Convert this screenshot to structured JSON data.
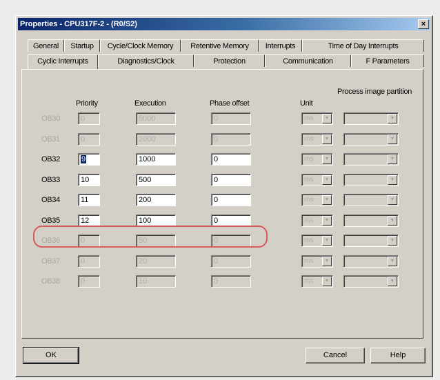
{
  "window": {
    "title": "Properties - CPU317F-2 - (R0/S2)",
    "close_glyph": "×"
  },
  "tabs": {
    "row1": [
      {
        "label": "General"
      },
      {
        "label": "Startup"
      },
      {
        "label": "Cycle/Clock Memory"
      },
      {
        "label": "Retentive Memory"
      },
      {
        "label": "Interrupts"
      },
      {
        "label": "Time of Day Interrupts"
      }
    ],
    "row2": [
      {
        "label": "Cyclic Interrupts",
        "active": true
      },
      {
        "label": "Diagnostics/Clock"
      },
      {
        "label": "Protection"
      },
      {
        "label": "Communication"
      },
      {
        "label": "F Parameters"
      }
    ]
  },
  "headers": {
    "priority": "Priority",
    "execution": "Execution",
    "phase_offset": "Phase offset",
    "unit": "Unit",
    "process_image": "Process image partition"
  },
  "rows": [
    {
      "ob": "OB30",
      "priority": "0",
      "execution": "5000",
      "phase": "0",
      "unit": "ms",
      "enabled": false
    },
    {
      "ob": "OB31",
      "priority": "0",
      "execution": "2000",
      "phase": "0",
      "unit": "ms",
      "enabled": false
    },
    {
      "ob": "OB32",
      "priority": "9",
      "execution": "1000",
      "phase": "0",
      "unit": "ms",
      "enabled": true
    },
    {
      "ob": "OB33",
      "priority": "10",
      "execution": "500",
      "phase": "0",
      "unit": "ms",
      "enabled": true
    },
    {
      "ob": "OB34",
      "priority": "11",
      "execution": "200",
      "phase": "0",
      "unit": "ms",
      "enabled": true
    },
    {
      "ob": "OB35",
      "priority": "12",
      "execution": "100",
      "phase": "0",
      "unit": "ms",
      "enabled": true,
      "highlighted": true
    },
    {
      "ob": "OB36",
      "priority": "0",
      "execution": "50",
      "phase": "0",
      "unit": "ms",
      "enabled": false
    },
    {
      "ob": "OB37",
      "priority": "0",
      "execution": "20",
      "phase": "0",
      "unit": "ms",
      "enabled": false
    },
    {
      "ob": "OB38",
      "priority": "0",
      "execution": "10",
      "phase": "0",
      "unit": "ms",
      "enabled": false
    }
  ],
  "buttons": {
    "ok": "OK",
    "cancel": "Cancel",
    "help": "Help"
  },
  "colors": {
    "titlebar_start": "#0a246a",
    "titlebar_end": "#a6caf0",
    "dialog_face": "#d4d0c8",
    "highlight_outline": "#d65c5c",
    "selection": "#0a246a"
  }
}
